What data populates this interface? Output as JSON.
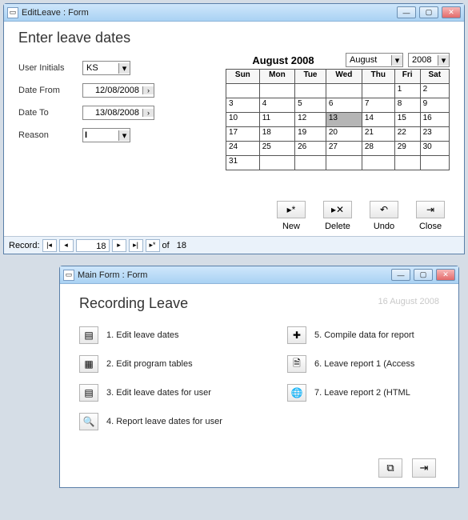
{
  "window1": {
    "title": "EditLeave : Form",
    "heading": "Enter leave dates",
    "form": {
      "userInitialsLabel": "User Initials",
      "userInitials": "KS",
      "dateFromLabel": "Date From",
      "dateFrom": "12/08/2008",
      "dateToLabel": "Date To",
      "dateTo": "13/08/2008",
      "reasonLabel": "Reason",
      "reason": "I"
    },
    "calendar": {
      "title": "August 2008",
      "monthSelect": "August",
      "yearSelect": "2008",
      "headers": [
        "Sun",
        "Mon",
        "Tue",
        "Wed",
        "Thu",
        "Fri",
        "Sat"
      ],
      "rows": [
        [
          "",
          "",
          "",
          "",
          "",
          "1",
          "2"
        ],
        [
          "3",
          "4",
          "5",
          "6",
          "7",
          "8",
          "9"
        ],
        [
          "10",
          "11",
          "12",
          "13",
          "14",
          "15",
          "16"
        ],
        [
          "17",
          "18",
          "19",
          "20",
          "21",
          "22",
          "23"
        ],
        [
          "24",
          "25",
          "26",
          "27",
          "28",
          "29",
          "30"
        ],
        [
          "31",
          "",
          "",
          "",
          "",
          "",
          ""
        ]
      ],
      "selectedDay": "13"
    },
    "toolbar": {
      "new": "New",
      "delete": "Delete",
      "undo": "Undo",
      "close": "Close"
    },
    "nav": {
      "label": "Record:",
      "current": "18",
      "of": "of",
      "total": "18"
    }
  },
  "window2": {
    "title": "Main Form : Form",
    "heading": "Recording Leave",
    "dateStamp": "16 August 2008",
    "items": [
      {
        "n": "1.",
        "label": "Edit leave dates"
      },
      {
        "n": "2.",
        "label": "Edit program tables"
      },
      {
        "n": "3.",
        "label": "Edit leave dates for user"
      },
      {
        "n": "4.",
        "label": "Report leave dates for user"
      },
      {
        "n": "5.",
        "label": "Compile data for report"
      },
      {
        "n": "6.",
        "label": "Leave report 1 (Access"
      },
      {
        "n": "7.",
        "label": "Leave report 2 (HTML"
      }
    ]
  }
}
